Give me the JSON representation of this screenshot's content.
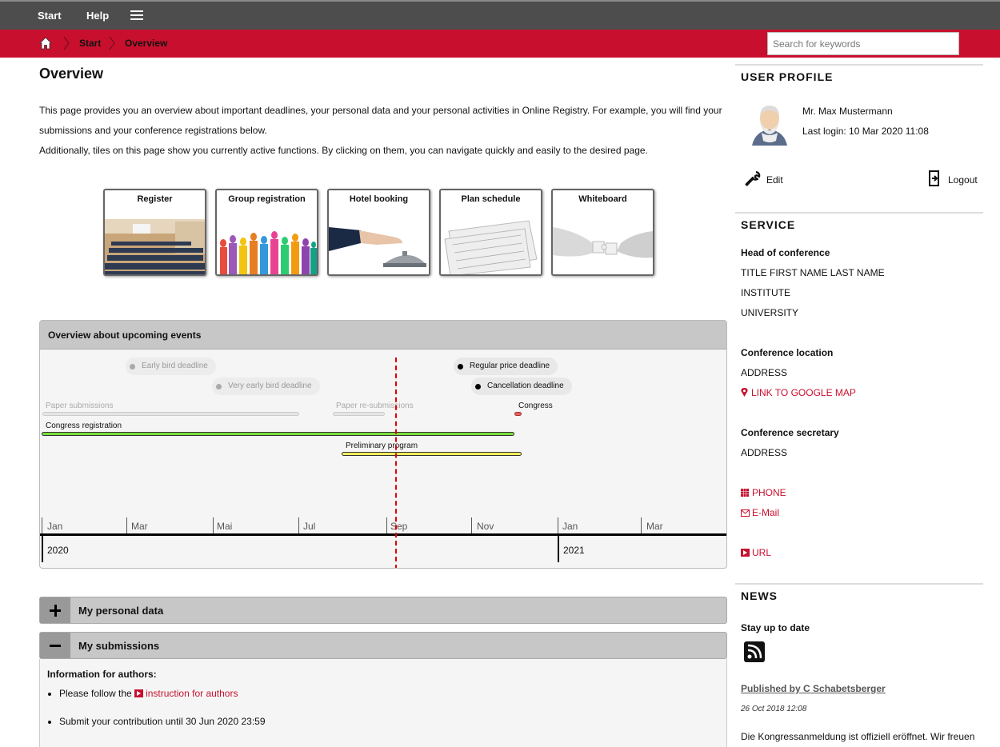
{
  "topbar": {
    "nav": [
      "Start",
      "Help"
    ],
    "menu_icon": "hamburger-menu-icon"
  },
  "breadcrumb": {
    "home_icon": "home-icon",
    "items": [
      "Start",
      "Overview"
    ]
  },
  "search": {
    "placeholder": "Search for keywords",
    "value": ""
  },
  "main": {
    "title": "Overview",
    "intro": [
      "This page provides you an overview about important deadlines, your personal data and your personal activities in Online Registry. For example, you will find your submissions and your conference registrations below.",
      "Additionally, tiles on this page show you currently active functions. By clicking on them, you can navigate quickly and easily to the desired page."
    ],
    "tiles": [
      {
        "label": "Register",
        "image": "lecture-hall-image"
      },
      {
        "label": "Group registration",
        "image": "colorful-people-silhouettes-image"
      },
      {
        "label": "Hotel booking",
        "image": "service-bell-image"
      },
      {
        "label": "Plan schedule",
        "image": "calendar-pages-image"
      },
      {
        "label": "Whiteboard",
        "image": "puzzle-hands-image"
      }
    ],
    "timeline": {
      "title": "Overview about upcoming events",
      "events": [
        {
          "label": "Early bird deadline",
          "state": "past"
        },
        {
          "label": "Very early bird deadline",
          "state": "past"
        },
        {
          "label": "Regular price deadline",
          "state": "upcoming"
        },
        {
          "label": "Cancellation deadline",
          "state": "upcoming"
        },
        {
          "label": "Paper submissions",
          "state": "past"
        },
        {
          "label": "Paper re-submissions",
          "state": "past"
        },
        {
          "label": "Congress",
          "state": "upcoming",
          "color": "#e06060"
        },
        {
          "label": "Congress registration",
          "state": "active",
          "color": "#7dde3c"
        },
        {
          "label": "Preliminary program",
          "state": "active",
          "color": "#f5ed5c"
        }
      ],
      "months": [
        "Jan",
        "Mar",
        "Mai",
        "Jul",
        "Sep",
        "Nov",
        "Jan",
        "Mar"
      ],
      "years": [
        "2020",
        "2021"
      ],
      "today_marker_color": "#e00000"
    },
    "accordions": [
      {
        "title": "My personal data",
        "expanded": false
      },
      {
        "title": "My submissions",
        "expanded": true
      }
    ],
    "submissions": {
      "info_title": "Information for authors:",
      "bullet1_prefix": "Please follow the",
      "bullet1_link": "instruction for authors",
      "bullet2": "Submit your contribution until 30 Jun 2020 23:59"
    }
  },
  "sidebar": {
    "user_profile": {
      "heading": "USER PROFILE",
      "name": "Mr. Max Mustermann",
      "last_login": "Last login: 10 Mar 2020 11:08",
      "edit": "Edit",
      "logout": "Logout"
    },
    "service": {
      "heading": "SERVICE",
      "head_label": "Head of conference",
      "head_name": "TITLE FIRST NAME LAST NAME",
      "institute": "INSTITUTE",
      "university": "UNIVERSITY",
      "location_label": "Conference location",
      "location_address": "ADDRESS",
      "map_link": "LINK TO GOOGLE MAP",
      "secretary_label": "Conference secretary",
      "secretary_address": "ADDRESS",
      "phone": "PHONE",
      "email": "E-Mail",
      "url": "URL"
    },
    "news": {
      "heading": "NEWS",
      "stay": "Stay up to date",
      "author": "Published by C Schabetsberger",
      "date": "26 Oct 2018 12:08",
      "text": "Die Kongressanmeldung ist offiziell eröffnet. Wir freuen"
    }
  },
  "colors": {
    "brand_red": "#c8102e",
    "topbar": "#4d4d4d",
    "link": "#c8102e"
  }
}
